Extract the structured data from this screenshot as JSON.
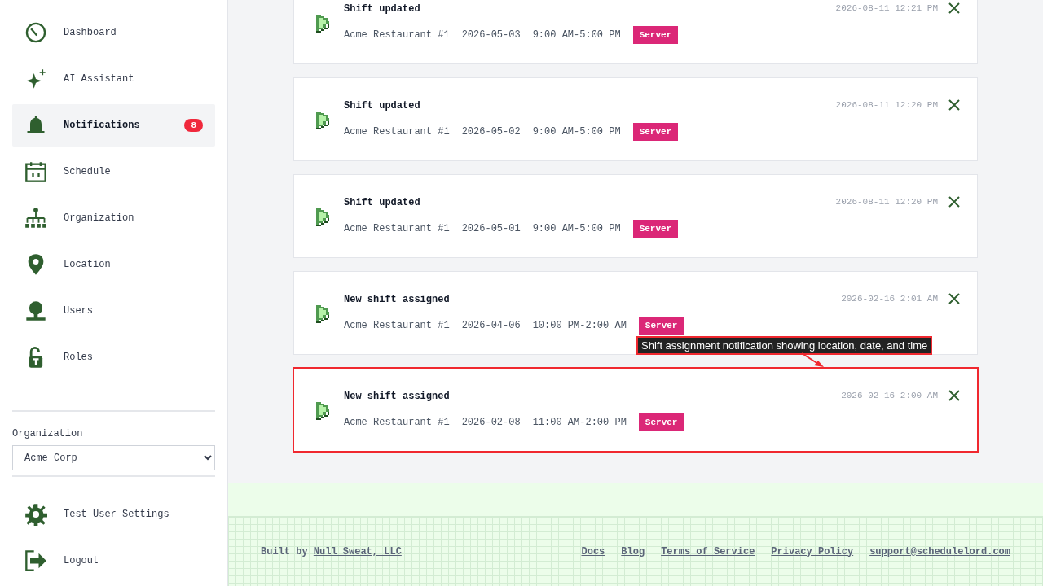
{
  "sidebar": {
    "items": [
      {
        "label": "Dashboard",
        "selected": false
      },
      {
        "label": "AI Assistant",
        "selected": false
      },
      {
        "label": "Notifications",
        "selected": true,
        "badge": "8"
      },
      {
        "label": "Schedule",
        "selected": false
      },
      {
        "label": "Organization",
        "selected": false
      },
      {
        "label": "Location",
        "selected": false
      },
      {
        "label": "Users",
        "selected": false
      },
      {
        "label": "Roles",
        "selected": false
      }
    ],
    "organization": {
      "label": "Organization",
      "value": "Acme Corp"
    },
    "bottom_items": [
      {
        "label": "Test User Settings"
      },
      {
        "label": "Logout"
      }
    ]
  },
  "notifications": [
    {
      "title": "Shift updated",
      "location": "Acme Restaurant #1",
      "date": "2026-05-03",
      "time": "9:00 AM-5:00 PM",
      "role": "Server",
      "timestamp": "2026-08-11 12:21 PM",
      "highlighted": false
    },
    {
      "title": "Shift updated",
      "location": "Acme Restaurant #1",
      "date": "2026-05-02",
      "time": "9:00 AM-5:00 PM",
      "role": "Server",
      "timestamp": "2026-08-11 12:20 PM",
      "highlighted": false
    },
    {
      "title": "Shift updated",
      "location": "Acme Restaurant #1",
      "date": "2026-05-01",
      "time": "9:00 AM-5:00 PM",
      "role": "Server",
      "timestamp": "2026-08-11 12:20 PM",
      "highlighted": false
    },
    {
      "title": "New shift assigned",
      "location": "Acme Restaurant #1",
      "date": "2026-04-06",
      "time": "10:00 PM-2:00 AM",
      "role": "Server",
      "timestamp": "2026-02-16 2:01 AM",
      "highlighted": false
    },
    {
      "title": "New shift assigned",
      "location": "Acme Restaurant #1",
      "date": "2026-02-08",
      "time": "11:00 AM-2:00 PM",
      "role": "Server",
      "timestamp": "2026-02-16 2:00 AM",
      "highlighted": true
    }
  ],
  "annotation": {
    "text": "Shift assignment notification showing location, date, and time"
  },
  "footer": {
    "built_by": "Built by",
    "author_link": "Null Sweat, LLC",
    "links": [
      "Docs",
      "Blog",
      "Terms of Service",
      "Privacy Policy",
      "support@schedulelord.com"
    ]
  }
}
